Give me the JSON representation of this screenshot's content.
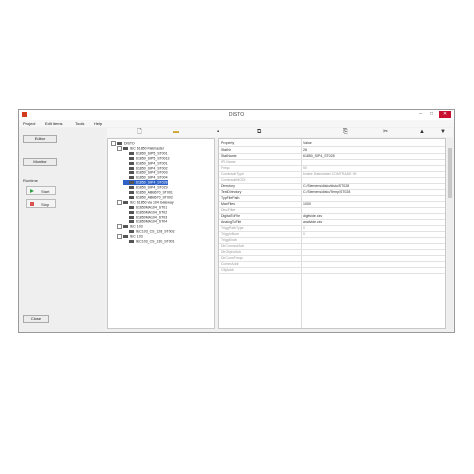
{
  "window": {
    "title": "DISTO",
    "minimize": "–",
    "maximize": "□",
    "close": "✕"
  },
  "menu": [
    "Project",
    "Edit items",
    "Tools",
    "Help"
  ],
  "left": {
    "editor": "Editor",
    "monitor": "Monitor",
    "runtime_label": "Runtime",
    "start": "Start",
    "stop": "Stop",
    "close": "Close"
  },
  "toolbar": {
    "icons": [
      "new-file-icon",
      "open-folder-icon",
      "save-icon",
      "copy-icon",
      "paste-icon",
      "cut-icon",
      "move-up-icon",
      "move-down-icon"
    ]
  },
  "tree": [
    {
      "label": "DISTO",
      "level": 0
    },
    {
      "label": "IEC 61850 Flatmaster",
      "level": 1
    },
    {
      "label": "61850_SIP5_ST001",
      "level": 2
    },
    {
      "label": "61850_SIP5_ST0013",
      "level": 2
    },
    {
      "label": "61850_SIP4_ST001",
      "level": 2
    },
    {
      "label": "61850_SIP4_ST002",
      "level": 2
    },
    {
      "label": "61850_SIP4_ST003",
      "level": 2
    },
    {
      "label": "61850_SIP4_ST004",
      "level": 2
    },
    {
      "label": "61850_SIP4_ST028",
      "level": 2,
      "selected": true
    },
    {
      "label": "61850_SIP4_ST029",
      "level": 2
    },
    {
      "label": "61850_ABB670_ST001",
      "level": 2
    },
    {
      "label": "61850_ABB670_ST002",
      "level": 2
    },
    {
      "label": "IEC 61850 via 104 Gateway",
      "level": 1
    },
    {
      "label": "61850MA104_ST01",
      "level": 2
    },
    {
      "label": "61850MA104_ST02",
      "level": 2
    },
    {
      "label": "61850MA104_ST03",
      "level": 2
    },
    {
      "label": "61850MA104_ST04",
      "level": 2
    },
    {
      "label": "IEC 103",
      "level": 1
    },
    {
      "label": "IEC103_CS_128_ST002",
      "level": 2
    },
    {
      "label": "IEC 103",
      "level": 1
    },
    {
      "label": "IEC103_CS_130_ST001",
      "level": 2
    }
  ],
  "properties": {
    "header": {
      "name": "Property",
      "value": "Value"
    },
    "rows": [
      {
        "name": "StatNr",
        "value": "28",
        "dim": false
      },
      {
        "name": "StatName",
        "value": "61850_SIP4_ST028",
        "dim": false
      },
      {
        "name": "IPI.Name",
        "value": "",
        "dim": true
      },
      {
        "name": "Freqc",
        "value": "50",
        "dim": true
      },
      {
        "name": "ComtradeType",
        "value": "binäre Datendatei COMTRADE 99",
        "dim": true
      },
      {
        "name": "ComtradeMODI",
        "value": "",
        "dim": true
      },
      {
        "name": "Directory",
        "value": "C:/Siemens/disto/disto/ST028",
        "dim": false
      },
      {
        "name": "TextDirectory",
        "value": "C:/Siemens/disto/Temp/ST028",
        "dim": false
      },
      {
        "name": "TypFilePath",
        "value": "",
        "dim": false
      },
      {
        "name": "MaxFiles",
        "value": "1000",
        "dim": false
      },
      {
        "name": "DiscFilter",
        "value": "",
        "dim": true
      },
      {
        "name": "DigitalToFile",
        "value": "digitvide.csv",
        "dim": false
      },
      {
        "name": "AnalogToFile",
        "value": "analvide.csv",
        "dim": false
      },
      {
        "name": "TriggPathType",
        "value": "0",
        "dim": true
      },
      {
        "name": "TriggInNum",
        "value": "0",
        "dim": true
      },
      {
        "name": "TriggEnab",
        "value": "",
        "dim": true
      },
      {
        "name": "DirConnectAdr",
        "value": "",
        "dim": true
      },
      {
        "name": "DirObjectAdr",
        "value": "",
        "dim": true
      },
      {
        "name": "DirConnFreqs",
        "value": "",
        "dim": true
      },
      {
        "name": "CommAddr",
        "value": "",
        "dim": true
      },
      {
        "name": "ObjAddr",
        "value": "",
        "dim": true
      }
    ]
  },
  "colors": {
    "selection": "#2e62c7",
    "close": "#c8102e",
    "start": "#2ea043",
    "stop": "#d9534f"
  }
}
